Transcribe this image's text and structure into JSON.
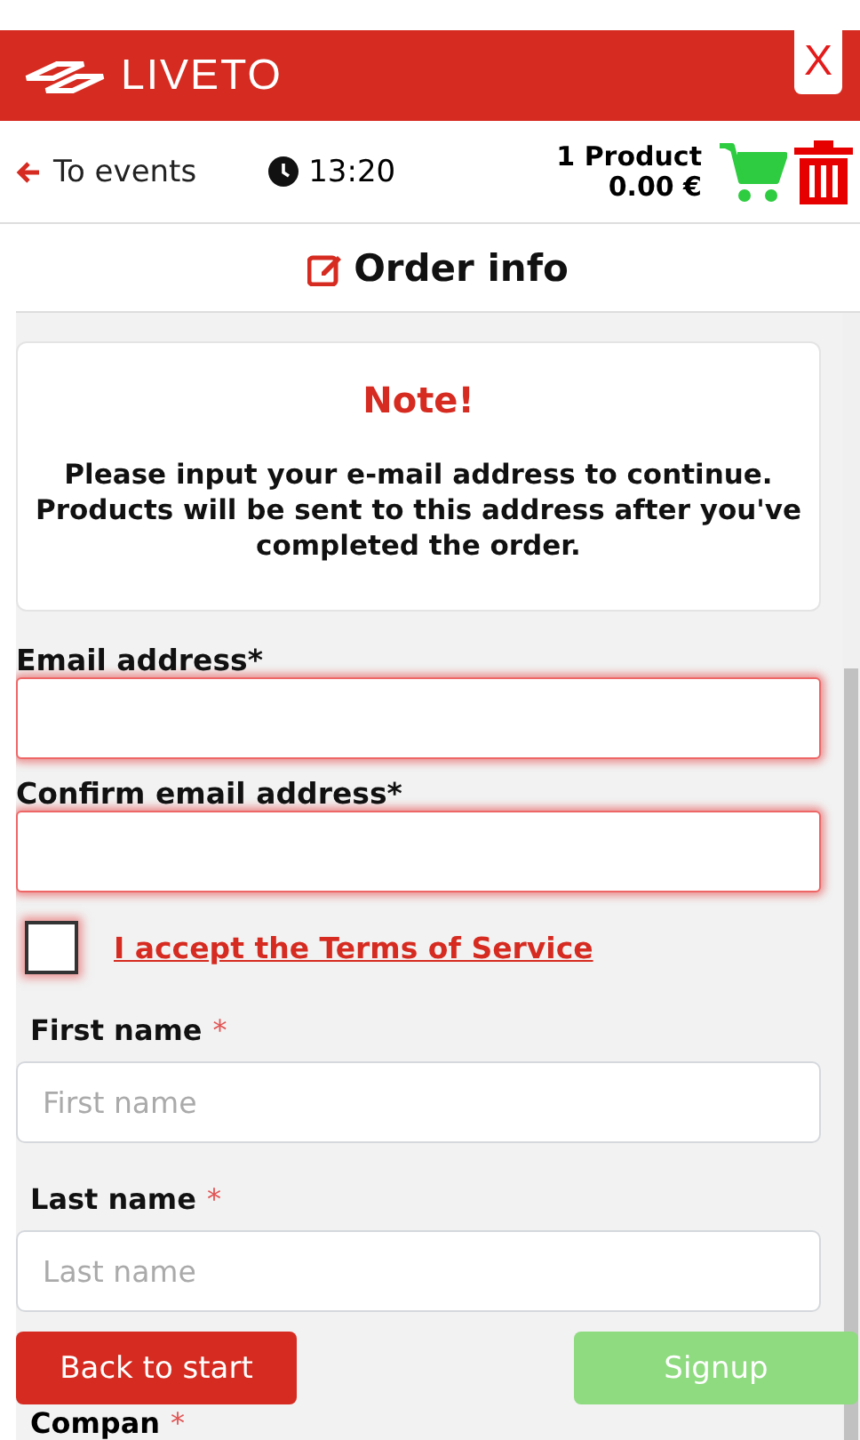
{
  "header": {
    "brand": "LIVETO",
    "close": "X"
  },
  "nav": {
    "back": "To events",
    "time": "13:20",
    "product_count": "1 Product",
    "total": "0.00 €"
  },
  "page_title": "Order info",
  "note": {
    "title": "Note!",
    "text": "Please input your e-mail address to continue. Products will be sent to this address after you've completed the order."
  },
  "email_fields": [
    {
      "label": "Email address*",
      "invalid": true
    },
    {
      "label": "Confirm email address*",
      "invalid": true
    }
  ],
  "terms": {
    "label": "I accept the Terms of Service",
    "checked": false,
    "invalid": true
  },
  "name_fields": [
    {
      "label": "First name",
      "required": "*",
      "placeholder": "First name"
    },
    {
      "label": "Last name",
      "required": "*",
      "placeholder": "Last name"
    }
  ],
  "cut_label": {
    "label": "Compan",
    "required": "*"
  },
  "buttons": {
    "back": "Back to start",
    "signup": "Signup",
    "signup_disabled": true
  }
}
